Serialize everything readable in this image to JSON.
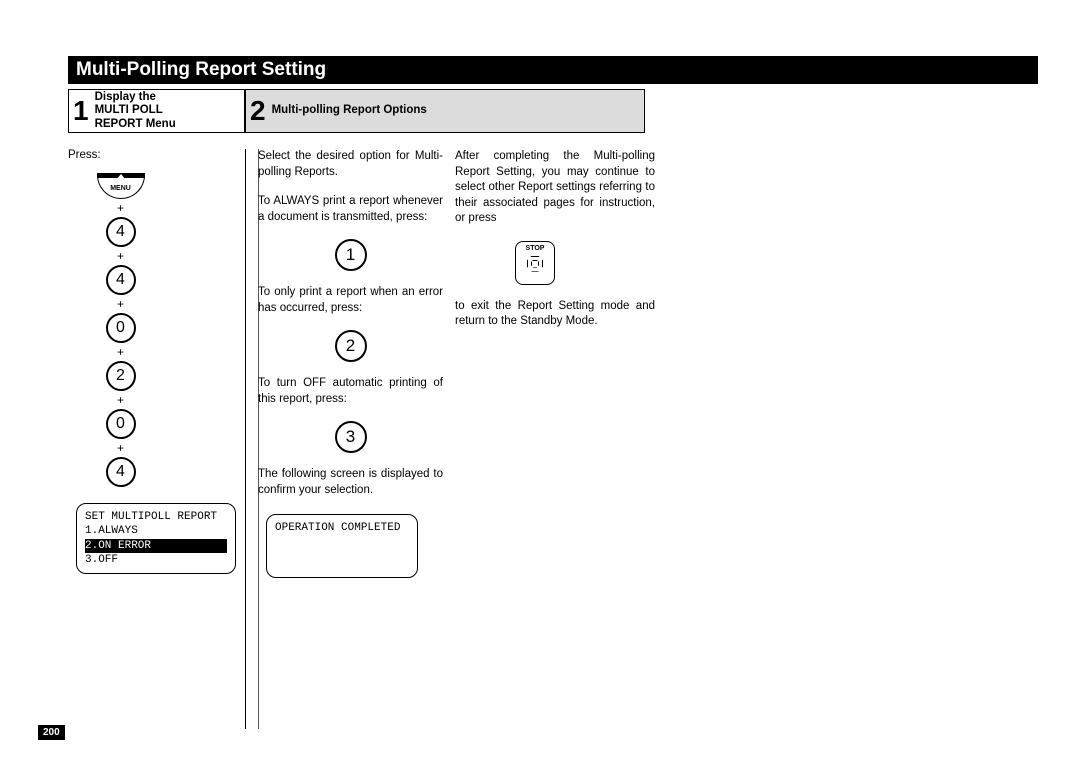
{
  "title": "Multi-Polling Report Setting",
  "steps": {
    "s1": {
      "num": "1",
      "line1": "Display the",
      "line2": "MULTI POLL",
      "line3": "REPORT Menu"
    },
    "s2": {
      "num": "2",
      "label": "Multi-polling Report Options"
    }
  },
  "col1": {
    "press": "Press:",
    "menu": "MENU",
    "keys": [
      "4",
      "4",
      "0",
      "2",
      "0",
      "4"
    ],
    "plus": "+",
    "lcd": {
      "l1": "SET MULTIPOLL REPORT",
      "l2": "1.ALWAYS",
      "l3": "2.ON ERROR",
      "l4": "3.OFF"
    }
  },
  "col2": {
    "p1": "Select the desired option for Multi-polling Reports.",
    "p2": "To ALWAYS print a report whenever a document is transmitted, press:",
    "k1": "1",
    "p3": "To only print a report when an error has occurred, press:",
    "k2": "2",
    "p4": "To turn OFF automatic printing of this report, press:",
    "k3": "3",
    "p5": "The following screen is displayed to confirm your selection.",
    "lcd": "OPERATION COMPLETED"
  },
  "col3": {
    "p1": "After completing the Multi-polling Report Setting, you may continue to select other Report settings referring to their associated pages for instruction, or press",
    "stop": "STOP",
    "p2": "to exit the Report Setting mode and return to the Standby Mode."
  },
  "page_number": "200"
}
